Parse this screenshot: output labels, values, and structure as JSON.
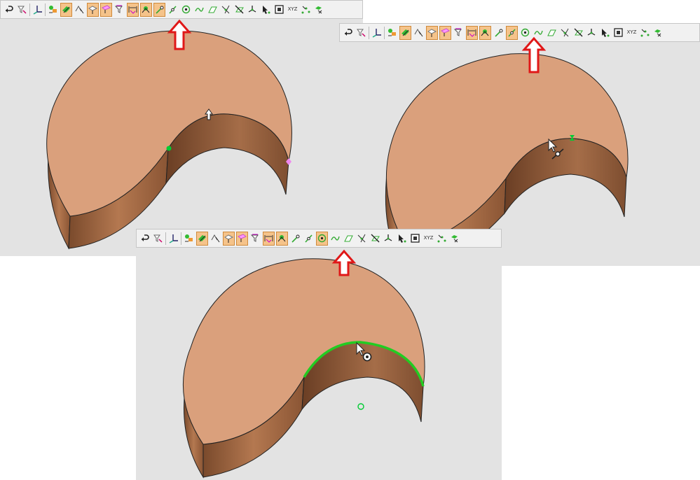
{
  "panels": [
    {
      "id": "p1",
      "description_key": "snap-endpoint",
      "active_tool": "point-snap-icon",
      "toolbar_text": {
        "xyz": "XYZ"
      }
    },
    {
      "id": "p2",
      "description_key": "snap-midpoint",
      "active_tool": "midpoint-snap-icon",
      "toolbar_text": {
        "xyz": "XYZ"
      }
    },
    {
      "id": "p3",
      "description_key": "snap-center",
      "active_tool": "center-snap-icon",
      "toolbar_text": {
        "xyz": "XYZ"
      }
    }
  ],
  "colors": {
    "panel_bg": "#e3e3e3",
    "top_face": "#daa07c",
    "side_face": "#9a6440",
    "highlight_edge": "#22cc22",
    "indicator_arrow": "#e01818",
    "toolbar_active": "#f5c38a",
    "snap_point": "#00cc33",
    "snap_pink": "#ee88ee"
  },
  "toolbar_icons": [
    "undo-arrow-icon",
    "filter-icon",
    "axis-select-icon",
    "select-layers-icon",
    "select-face-icon",
    "select-edge-icon",
    "select-vertex-icon",
    "select-solid-icon",
    "select-filter-icon",
    "dimension-icon",
    "snap-grid-icon",
    "point-snap-icon",
    "midpoint-snap-icon",
    "center-snap-icon",
    "curve-snap-icon",
    "plane-snap-icon",
    "intersection-snap-icon",
    "no-snap-icon",
    "axis-triad-icon",
    "cursor-snap-icon",
    "box-icon",
    "xyz-icon",
    "scatter-icon",
    "multi-snap-icon"
  ]
}
